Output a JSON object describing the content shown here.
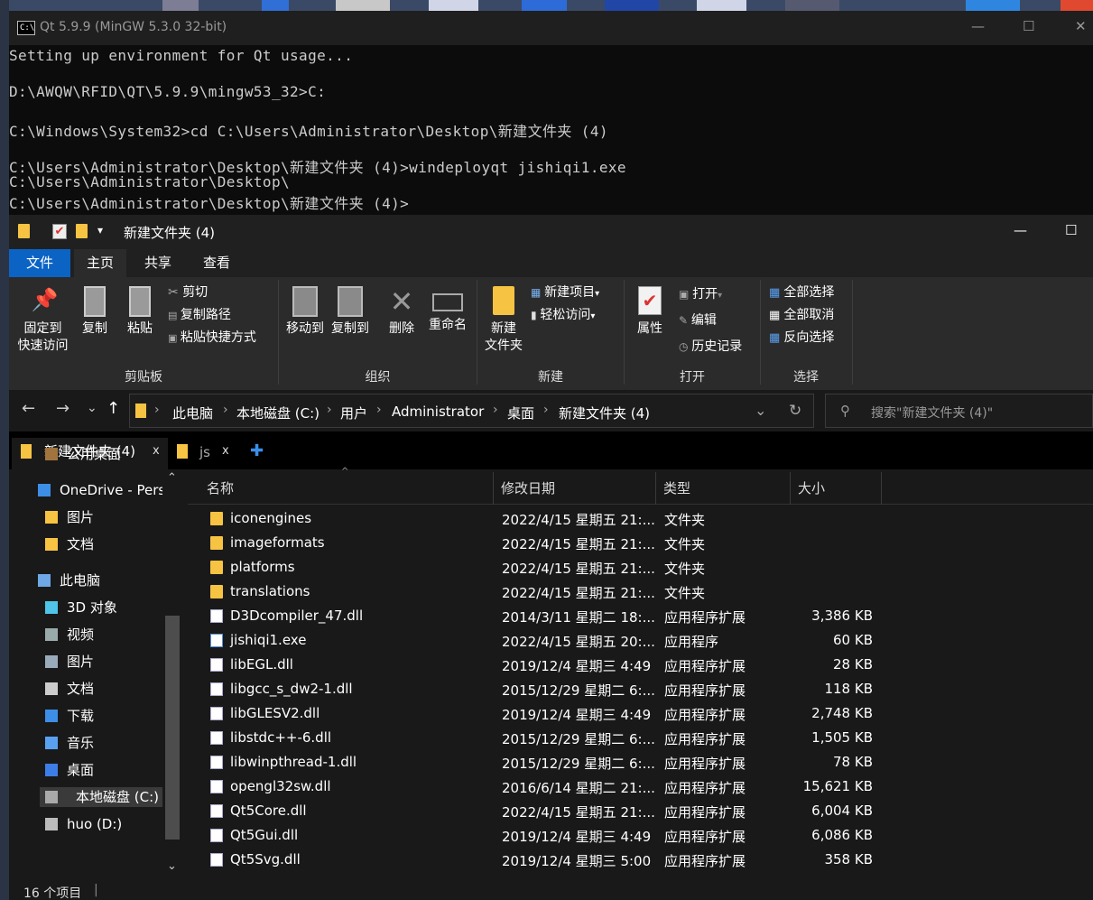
{
  "console": {
    "title": "Qt 5.9.9 (MinGW 5.3.0 32-bit)",
    "icon_text": "C:\\",
    "controls": {
      "min": "—",
      "max": "☐",
      "close": "✕"
    },
    "lines": [
      "Setting up environment for Qt usage...",
      "D:\\AWQW\\RFID\\QT\\5.9.9\\mingw53_32>C:",
      "C:\\Windows\\System32>cd C:\\Users\\Administrator\\Desktop\\新建文件夹 (4)",
      "C:\\Users\\Administrator\\Desktop\\新建文件夹 (4)>windeployqt jishiqi1.exe",
      "C:\\Users\\Administrator\\Desktop\\",
      "C:\\Users\\Administrator\\Desktop\\新建文件夹 (4)>"
    ]
  },
  "explorer": {
    "title": "新建文件夹 (4)",
    "qat_dropdown": "▾",
    "controls": {
      "min": "—",
      "max": "☐"
    },
    "ribbon_tabs": [
      "文件",
      "主页",
      "共享",
      "查看"
    ],
    "ribbon": {
      "pin": "固定到",
      "pin2": "快速访问",
      "copy": "复制",
      "paste": "粘贴",
      "cut": "剪切",
      "copy_path": "复制路径",
      "paste_shortcut": "粘贴快捷方式",
      "group_clipboard": "剪贴板",
      "move_to": "移动到",
      "copy_to": "复制到",
      "delete": "删除",
      "rename": "重命名",
      "group_organize": "组织",
      "new_folder": "新建",
      "new_folder2": "文件夹",
      "new_item": "新建项目",
      "easy_access": "轻松访问",
      "group_new": "新建",
      "properties": "属性",
      "open": "打开",
      "edit": "编辑",
      "history": "历史记录",
      "group_open": "打开",
      "select_all": "全部选择",
      "select_none": "全部取消",
      "invert": "反向选择",
      "group_select": "选择",
      "caret": "▾"
    },
    "nav": {
      "back": "←",
      "forward": "→",
      "recent": "⌄",
      "up": "↑",
      "dropdown": "⌄",
      "refresh": "↻"
    },
    "breadcrumb": [
      "此电脑",
      "本地磁盘 (C:)",
      "用户",
      "Administrator",
      "桌面",
      "新建文件夹 (4)"
    ],
    "crumb_sep": "›",
    "search_placeholder": "搜索\"新建文件夹 (4)\"",
    "tabs": [
      {
        "label": "新建文件夹 (4)",
        "close": "x"
      },
      {
        "label": "js",
        "close": "x"
      }
    ],
    "add_tab": "✚",
    "sidebar": [
      {
        "label": "公用桌面",
        "color": "#a0743c"
      },
      {
        "label": "OneDrive - Perso",
        "color": "#3d8ee6"
      },
      {
        "label": "图片",
        "color": "#f6c343"
      },
      {
        "label": "文档",
        "color": "#f6c343"
      },
      {
        "label": "此电脑",
        "color": "#6ea8e6"
      },
      {
        "label": "3D 对象",
        "color": "#4fc3e8"
      },
      {
        "label": "视频",
        "color": "#9aa"
      },
      {
        "label": "图片",
        "color": "#9ab"
      },
      {
        "label": "文档",
        "color": "#ccc"
      },
      {
        "label": "下载",
        "color": "#3d8ee6"
      },
      {
        "label": "音乐",
        "color": "#5aa0f0"
      },
      {
        "label": "桌面",
        "color": "#3d7ee6"
      },
      {
        "label": "本地磁盘 (C:)",
        "color": "#aaa"
      },
      {
        "label": "huo (D:)",
        "color": "#bbb"
      }
    ],
    "sidebar_scroll": {
      "up": "⌃",
      "down": "⌄"
    },
    "columns": [
      "名称",
      "修改日期",
      "类型",
      "大小"
    ],
    "sort_indicator": "^",
    "files": [
      {
        "name": "iconengines",
        "date": "2022/4/15 星期五 21:...",
        "type": "文件夹",
        "size": "",
        "kind": "folder"
      },
      {
        "name": "imageformats",
        "date": "2022/4/15 星期五 21:...",
        "type": "文件夹",
        "size": "",
        "kind": "folder"
      },
      {
        "name": "platforms",
        "date": "2022/4/15 星期五 21:...",
        "type": "文件夹",
        "size": "",
        "kind": "folder"
      },
      {
        "name": "translations",
        "date": "2022/4/15 星期五 21:...",
        "type": "文件夹",
        "size": "",
        "kind": "folder"
      },
      {
        "name": "D3Dcompiler_47.dll",
        "date": "2014/3/11 星期二 18:...",
        "type": "应用程序扩展",
        "size": "3,386 KB",
        "kind": "file"
      },
      {
        "name": "jishiqi1.exe",
        "date": "2022/4/15 星期五 20:...",
        "type": "应用程序",
        "size": "60 KB",
        "kind": "exe"
      },
      {
        "name": "libEGL.dll",
        "date": "2019/12/4 星期三 4:49",
        "type": "应用程序扩展",
        "size": "28 KB",
        "kind": "file"
      },
      {
        "name": "libgcc_s_dw2-1.dll",
        "date": "2015/12/29 星期二 6:...",
        "type": "应用程序扩展",
        "size": "118 KB",
        "kind": "file"
      },
      {
        "name": "libGLESV2.dll",
        "date": "2019/12/4 星期三 4:49",
        "type": "应用程序扩展",
        "size": "2,748 KB",
        "kind": "file"
      },
      {
        "name": "libstdc++-6.dll",
        "date": "2015/12/29 星期二 6:...",
        "type": "应用程序扩展",
        "size": "1,505 KB",
        "kind": "file"
      },
      {
        "name": "libwinpthread-1.dll",
        "date": "2015/12/29 星期二 6:...",
        "type": "应用程序扩展",
        "size": "78 KB",
        "kind": "file"
      },
      {
        "name": "opengl32sw.dll",
        "date": "2016/6/14 星期二 21:...",
        "type": "应用程序扩展",
        "size": "15,621 KB",
        "kind": "file"
      },
      {
        "name": "Qt5Core.dll",
        "date": "2022/4/15 星期五 21:...",
        "type": "应用程序扩展",
        "size": "6,004 KB",
        "kind": "file"
      },
      {
        "name": "Qt5Gui.dll",
        "date": "2019/12/4 星期三 4:49",
        "type": "应用程序扩展",
        "size": "6,086 KB",
        "kind": "file"
      },
      {
        "name": "Qt5Svg.dll",
        "date": "2019/12/4 星期三 5:00",
        "type": "应用程序扩展",
        "size": "358 KB",
        "kind": "file"
      }
    ],
    "status": "16 个项目",
    "status_sep": "|"
  },
  "colors": {
    "accent": "#0b63c4",
    "folder": "#f6c343"
  }
}
